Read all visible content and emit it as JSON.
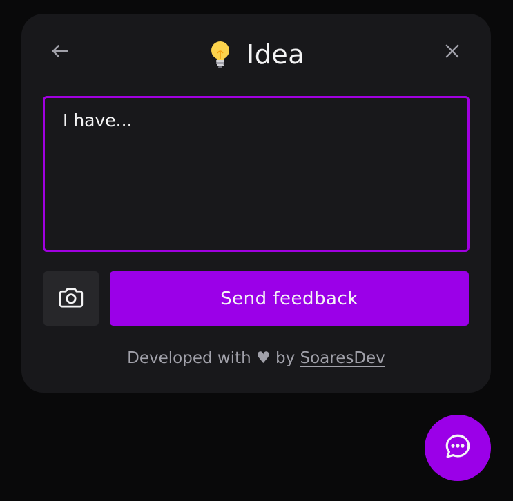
{
  "widget": {
    "title": "Idea",
    "title_icon": "lightbulb-icon",
    "back_icon": "arrow-left-icon",
    "close_icon": "close-icon",
    "textarea_value": "I have...",
    "camera_icon": "camera-icon",
    "send_label": "Send feedback",
    "footer_prefix": "Developed with",
    "footer_heart": "♥",
    "footer_by": "by",
    "footer_link": "SoaresDev"
  },
  "launcher": {
    "icon": "chat-bubble-icon"
  },
  "colors": {
    "background": "#09090a",
    "panel": "#18181b",
    "accent": "#9b00e8",
    "text": "#f4f4f5",
    "muted": "#a1a1aa",
    "button_secondary": "#27272a"
  }
}
